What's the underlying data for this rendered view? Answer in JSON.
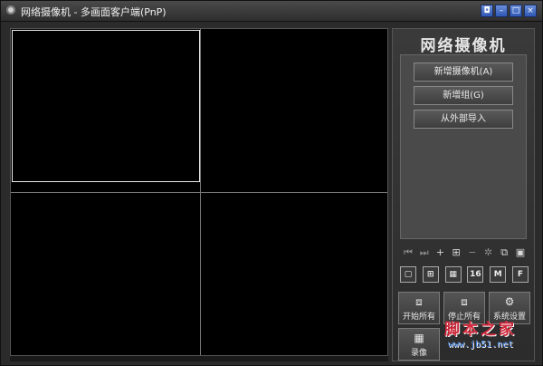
{
  "window": {
    "title": "网络摄像机 - 多画面客户端(PnP)",
    "controls": [
      "◘",
      "–",
      "□",
      "×"
    ]
  },
  "panel": {
    "header": "网络摄像机",
    "buttons": [
      "新增摄像机(A)",
      "新增组(G)",
      "从外部导入"
    ],
    "toolbar": [
      "⏮",
      "⏭",
      "+",
      "⊞",
      "−",
      "✲",
      "⧉",
      "▣"
    ],
    "layouts": [
      "▢",
      "⊞",
      "▦",
      "16",
      "M",
      "F"
    ],
    "actions": [
      {
        "icon": "⧈",
        "label": "开始所有"
      },
      {
        "icon": "⧈",
        "label": "停止所有"
      },
      {
        "icon": "⚙",
        "label": "系统设置"
      },
      {
        "icon": "▦",
        "label": "录像"
      }
    ]
  },
  "watermark": {
    "main": "脚本之家",
    "url": "www.jb51.net"
  },
  "colors": {
    "titlebar": "#2e2e2e",
    "panel": "#3a3a3a",
    "video": "#000000",
    "window_buttons": "#2f57b5",
    "watermark_red": "#d0283b",
    "watermark_blue": "#3d7bd8"
  }
}
